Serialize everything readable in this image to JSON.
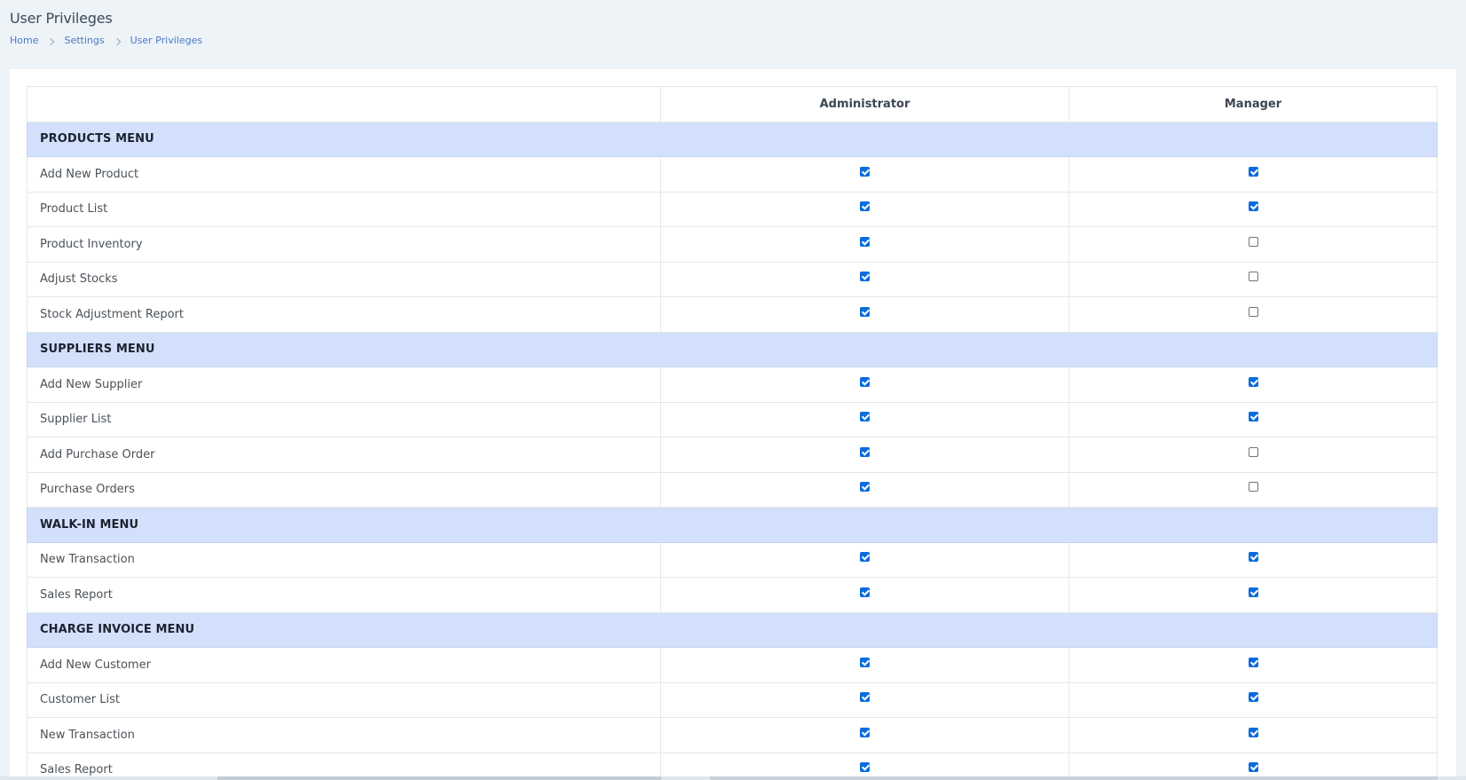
{
  "header": {
    "title": "User Privileges",
    "breadcrumb": [
      "Home",
      "Settings",
      "User Privileges"
    ]
  },
  "table": {
    "columns": [
      "",
      "Administrator",
      "Manager"
    ],
    "sections": [
      {
        "title": "PRODUCTS MENU",
        "rows": [
          {
            "label": "Add New Product",
            "administrator": true,
            "manager": true
          },
          {
            "label": "Product List",
            "administrator": true,
            "manager": true
          },
          {
            "label": "Product Inventory",
            "administrator": true,
            "manager": false
          },
          {
            "label": "Adjust Stocks",
            "administrator": true,
            "manager": false
          },
          {
            "label": "Stock Adjustment Report",
            "administrator": true,
            "manager": false
          }
        ]
      },
      {
        "title": "SUPPLIERS MENU",
        "rows": [
          {
            "label": "Add New Supplier",
            "administrator": true,
            "manager": true
          },
          {
            "label": "Supplier List",
            "administrator": true,
            "manager": true
          },
          {
            "label": "Add Purchase Order",
            "administrator": true,
            "manager": false
          },
          {
            "label": "Purchase Orders",
            "administrator": true,
            "manager": false
          }
        ]
      },
      {
        "title": "WALK-IN MENU",
        "rows": [
          {
            "label": "New Transaction",
            "administrator": true,
            "manager": true
          },
          {
            "label": "Sales Report",
            "administrator": true,
            "manager": true
          }
        ]
      },
      {
        "title": "CHARGE INVOICE MENU",
        "rows": [
          {
            "label": "Add New Customer",
            "administrator": true,
            "manager": true
          },
          {
            "label": "Customer List",
            "administrator": true,
            "manager": true
          },
          {
            "label": "New Transaction",
            "administrator": true,
            "manager": true
          },
          {
            "label": "Sales Report",
            "administrator": true,
            "manager": true
          }
        ]
      }
    ]
  },
  "colors": {
    "page_bg": "#edf3f7",
    "section_bg": "#d3e0fb",
    "checkbox_accent": "#0a6cdc",
    "link": "#4e79c4"
  }
}
